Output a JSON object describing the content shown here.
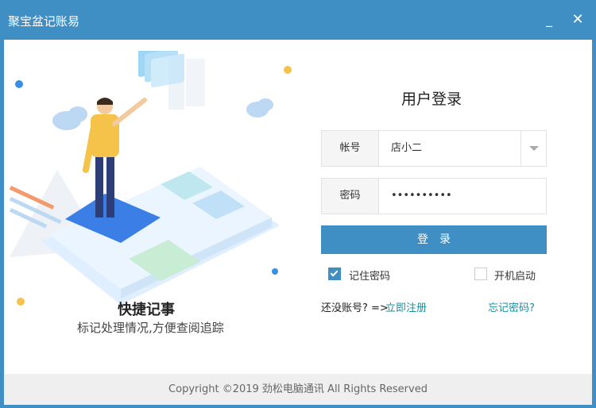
{
  "window": {
    "title": "聚宝盆记账易",
    "minimize_label": "_",
    "close_label": "✕"
  },
  "illustration": {
    "caption_main": "快捷记事",
    "caption_sub": "标记处理情况,方便查阅追踪",
    "colors": {
      "primary": "#3a8ee6",
      "accent_yellow": "#f6c34a",
      "accent_orange": "#f29a6c"
    }
  },
  "login": {
    "title": "用户登录",
    "account_label": "帐号",
    "account_value": "店小二",
    "password_label": "密码",
    "password_value": "••••••••••",
    "submit_label": "登录",
    "remember_label": "记住密码",
    "remember_checked": true,
    "autostart_label": "开机启动",
    "autostart_checked": false,
    "no_account_text": "还没账号? =>",
    "register_link": "立即注册",
    "forgot_link": "忘记密码?"
  },
  "footer": {
    "copyright": "Copyright ©2019 劲松电脑通讯 All Rights Reserved"
  },
  "colors": {
    "brand": "#3f8fc4",
    "link": "#1a8fa0"
  }
}
